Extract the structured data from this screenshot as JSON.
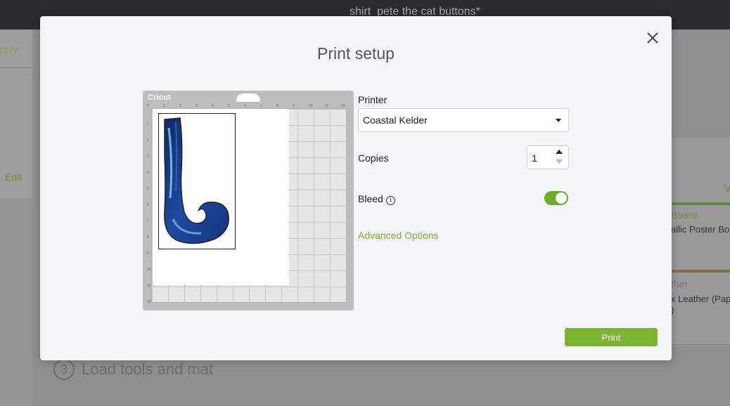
{
  "app": {
    "document_title": "shirt_pete the cat buttons*"
  },
  "background": {
    "apply_label": "pply",
    "edit_label": "Edit",
    "step3_number": "3",
    "step3_label": "Load tools and mat",
    "material_v": "V",
    "material1_category": "Board",
    "material1_name": "allic Poster Bo",
    "material2_category": "ther",
    "material2_name": "x Leather (Pap",
    "material2_suffix": ")"
  },
  "modal": {
    "title": "Print setup",
    "mat_brand": "Cricut",
    "mat_ruler_top": [
      "0",
      "1",
      "2",
      "3",
      "4",
      "5",
      "6",
      "7",
      "8",
      "9",
      "10",
      "11",
      "12"
    ],
    "mat_ruler_left": [
      "1",
      "2",
      "3",
      "4",
      "5",
      "6",
      "7",
      "8",
      "9",
      "10",
      "11",
      "12"
    ],
    "printer_label": "Printer",
    "printer_value": "Coastal Kelder",
    "copies_label": "Copies",
    "copies_value": "1",
    "bleed_label": "Bleed",
    "bleed_info_glyph": "i",
    "bleed_enabled": true,
    "advanced_options_label": "Advanced Options",
    "print_label": "Print"
  },
  "colors": {
    "accent_green": "#7cb330",
    "toggle_on": "#6fac2e",
    "link_green": "#7ab42d",
    "artwork_blue": "#1d3f8c"
  },
  "icons": {
    "close": "close-icon",
    "dropdown": "chevron-down-icon",
    "stepper_up": "triangle-up-icon",
    "stepper_down": "triangle-down-icon",
    "info": "info-icon"
  }
}
